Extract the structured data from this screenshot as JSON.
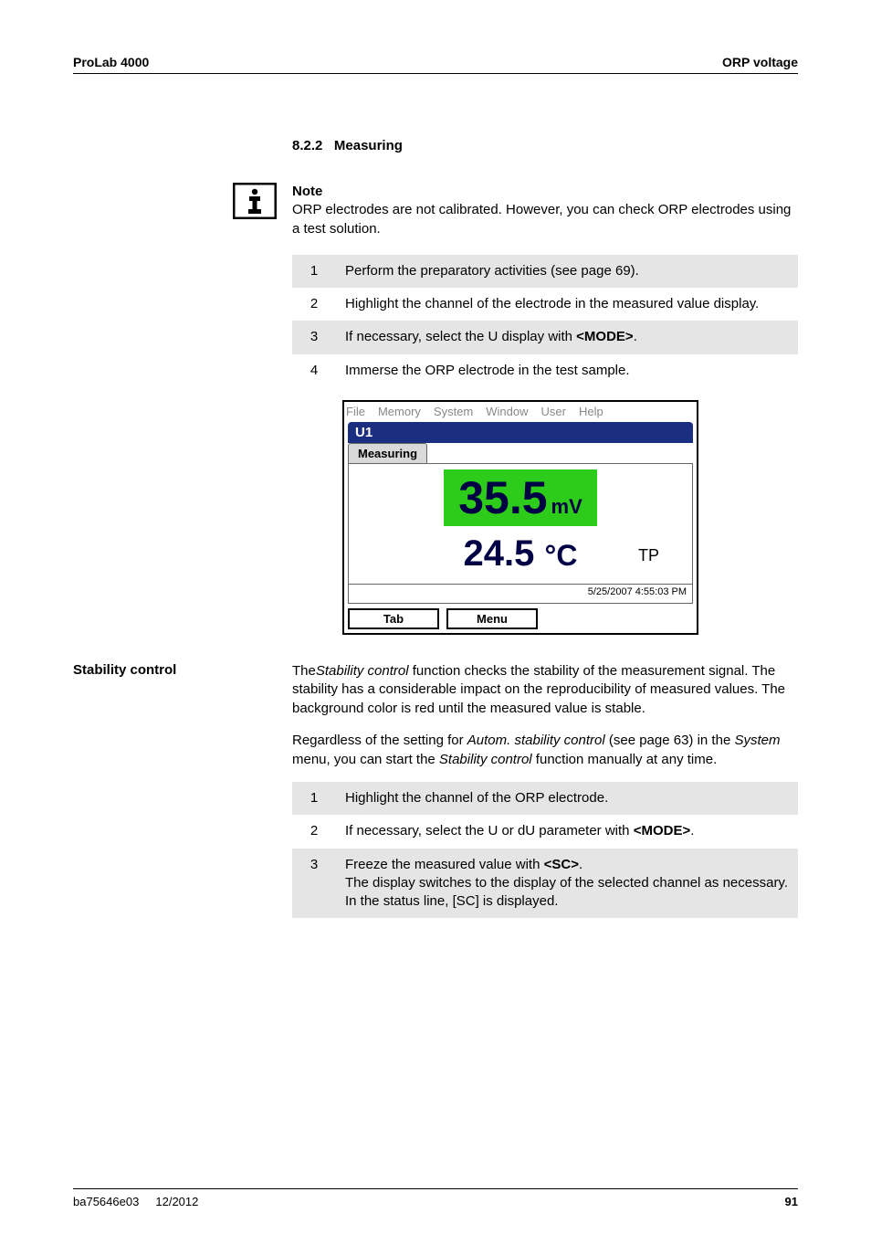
{
  "header": {
    "left": "ProLab 4000",
    "right": "ORP voltage"
  },
  "section": {
    "number": "8.2.2",
    "title": "Measuring"
  },
  "note": {
    "label": "Note",
    "body": "ORP electrodes are not calibrated. However, you can check ORP electrodes using a test solution."
  },
  "steps1": [
    {
      "n": "1",
      "text": "Perform the preparatory activities (see page 69)."
    },
    {
      "n": "2",
      "text": "Highlight the channel of the electrode in the measured value display."
    },
    {
      "n": "3",
      "text_pre": "If necessary, select the U display with ",
      "key": "<MODE>",
      "text_post": "."
    },
    {
      "n": "4",
      "text": "Immerse the ORP electrode in the test sample."
    }
  ],
  "screenshot": {
    "menus": [
      "File",
      "Memory",
      "System",
      "Window",
      "User",
      "Help"
    ],
    "channel": "U1",
    "tab": "Measuring",
    "main_value": "35.5",
    "main_unit": "mV",
    "temp_value": "24.5",
    "temp_unit": "°C",
    "tp": "TP",
    "timestamp": "5/25/2007 4:55:03 PM",
    "buttons": [
      "Tab",
      "Menu"
    ]
  },
  "stability": {
    "side": "Stability control",
    "p1_pre": "The",
    "p1_em1": "Stability control",
    "p1_mid": " function checks the stability of the measurement signal. The stability has a considerable impact on the reproducibility of measured values. The background color is red until the measured value is stable.",
    "p2_pre": "Regardless of the setting for ",
    "p2_em1": "Autom. stability control",
    "p2_mid": " (see page 63) in the ",
    "p2_em2": "System",
    "p2_mid2": " menu, you can start the ",
    "p2_em3": "Stability control",
    "p2_post": " function manually at any time."
  },
  "steps2": [
    {
      "n": "1",
      "text": "Highlight the channel of the ORP electrode."
    },
    {
      "n": "2",
      "text_pre": "If necessary, select the U or dU parameter with ",
      "key": "<MODE>",
      "text_post": "."
    },
    {
      "n": "3",
      "l1_pre": "Freeze the measured value with ",
      "l1_key": "<SC>",
      "l1_post": ".",
      "l2": "The display switches to the display of the selected channel as necessary.",
      "l3": "In the status line, [SC] is displayed."
    }
  ],
  "footer": {
    "left1": "ba75646e03",
    "left2": "12/2012",
    "page": "91"
  }
}
